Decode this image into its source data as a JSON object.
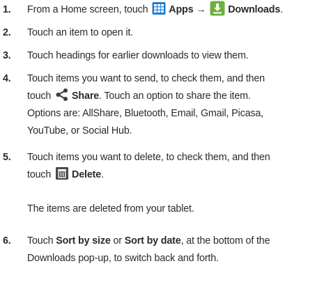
{
  "steps": [
    {
      "num": "1.",
      "lines": [
        {
          "pre": "From a Home screen, touch ",
          "b1": "Apps →",
          "b2": "Downloads",
          "post": "."
        }
      ]
    },
    {
      "num": "2.",
      "text": "Touch an item to open it."
    },
    {
      "num": "3.",
      "text": "Touch headings for earlier downloads to view them."
    },
    {
      "num": "4.",
      "line1": "Touch items you want to send, to check them, and then",
      "line2_pre": "touch ",
      "line2_bold": "Share",
      "line2_post": ". Touch an option to share the item.",
      "line3": "Options are: AllShare, Bluetooth, Email, Gmail, Picasa,",
      "line4": "YouTube, or Social Hub."
    },
    {
      "num": "5.",
      "line1": "Touch items you want to delete, to check them, and then",
      "line2_pre": "touch ",
      "line2_bold": "Delete",
      "line2_post": ".",
      "note": "The items are deleted from your tablet."
    },
    {
      "num": "6.",
      "line1_pre": "Touch ",
      "line1_b1": "Sort by size",
      "line1_mid": " or ",
      "line1_b2": "Sort by date",
      "line1_post": ", at the bottom of the",
      "line2": "Downloads pop-up, to switch back and forth."
    }
  ],
  "icons": {
    "apps": "apps-grid-icon",
    "downloads": "downloads-icon",
    "share": "share-icon",
    "delete": "trash-icon"
  },
  "colors": {
    "apps_blue": "#1f7fd0",
    "downloads_green": "#6ab23a",
    "text": "#2a2a2a"
  }
}
